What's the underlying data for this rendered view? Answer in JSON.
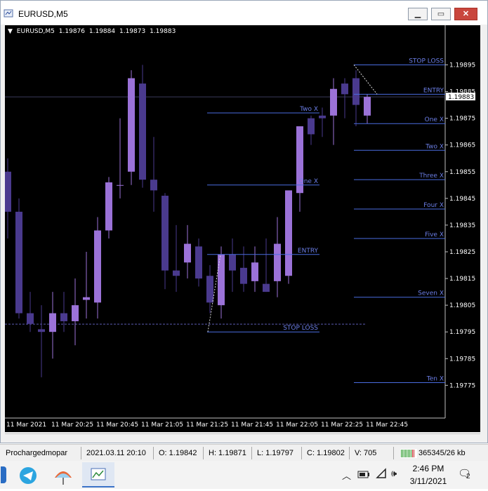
{
  "window": {
    "title": "EURUSD,M5"
  },
  "chart_header": {
    "symbol": "EURUSD,M5",
    "ohlc": [
      "1.19876",
      "1.19884",
      "1.19873",
      "1.19883"
    ]
  },
  "current_price_label": "1.19883",
  "y_axis_ticks": [
    "1.19895",
    "1.19885",
    "1.19875",
    "1.19865",
    "1.19855",
    "1.19845",
    "1.19835",
    "1.19825",
    "1.19815",
    "1.19805",
    "1.19795",
    "1.19785",
    "1.19775"
  ],
  "x_axis_ticks": [
    "11 Mar 2021",
    "11 Mar 20:25",
    "11 Mar 20:45",
    "11 Mar 21:05",
    "11 Mar 21:25",
    "11 Mar 21:45",
    "11 Mar 22:05",
    "11 Mar 22:25",
    "11 Mar 22:45"
  ],
  "chart_data": {
    "type": "candlestick",
    "ylim": [
      1.19768,
      1.19903
    ],
    "bull_color": "#9b72d8",
    "bear_color": "#4a3a8e",
    "candles": [
      [
        1.19855,
        1.1986,
        1.1983,
        1.1984
      ],
      [
        1.1984,
        1.19845,
        1.198,
        1.19802
      ],
      [
        1.19802,
        1.1981,
        1.19795,
        1.19798
      ],
      [
        1.19796,
        1.19805,
        1.19778,
        1.19795
      ],
      [
        1.19795,
        1.1981,
        1.19785,
        1.19802
      ],
      [
        1.19802,
        1.1981,
        1.19795,
        1.19799
      ],
      [
        1.19799,
        1.19815,
        1.1979,
        1.19805
      ],
      [
        1.19807,
        1.19825,
        1.198,
        1.19808
      ],
      [
        1.19806,
        1.19838,
        1.198,
        1.19833
      ],
      [
        1.19833,
        1.19853,
        1.1983,
        1.19851
      ],
      [
        1.1985,
        1.19875,
        1.19845,
        1.1985
      ],
      [
        1.19855,
        1.19893,
        1.1985,
        1.1989
      ],
      [
        1.19888,
        1.19895,
        1.19849,
        1.19852
      ],
      [
        1.19852,
        1.19868,
        1.1984,
        1.19848
      ],
      [
        1.19846,
        1.19847,
        1.19811,
        1.19818
      ],
      [
        1.19818,
        1.19835,
        1.1981,
        1.19816
      ],
      [
        1.19821,
        1.19835,
        1.19815,
        1.19828
      ],
      [
        1.19827,
        1.1983,
        1.19812,
        1.19815
      ],
      [
        1.19816,
        1.1982,
        1.19802,
        1.19806
      ],
      [
        1.19805,
        1.19827,
        1.198,
        1.19824
      ],
      [
        1.19824,
        1.1983,
        1.1981,
        1.19818
      ],
      [
        1.19819,
        1.19827,
        1.1981,
        1.19813
      ],
      [
        1.19814,
        1.19827,
        1.1981,
        1.19821
      ],
      [
        1.19813,
        1.1983,
        1.1981,
        1.1981
      ],
      [
        1.19814,
        1.19838,
        1.19808,
        1.19828
      ],
      [
        1.19816,
        1.19845,
        1.19813,
        1.19848
      ],
      [
        1.19847,
        1.1987,
        1.1984,
        1.19872
      ],
      [
        1.19875,
        1.19876,
        1.19865,
        1.19869
      ],
      [
        1.19876,
        1.19879,
        1.19868,
        1.19875
      ],
      [
        1.19876,
        1.1989,
        1.19865,
        1.19886
      ],
      [
        1.19888,
        1.1989,
        1.19875,
        1.19884
      ],
      [
        1.1989,
        1.19893,
        1.19872,
        1.1988
      ],
      [
        1.19876,
        1.19884,
        1.19873,
        1.19883
      ]
    ],
    "trade_1": {
      "levels": [
        {
          "label": "Two X",
          "price": 1.19877
        },
        {
          "label": "One X",
          "price": 1.1985
        },
        {
          "label": "ENTRY",
          "price": 1.19824
        },
        {
          "label": "STOP LOSS",
          "price": 1.19795
        }
      ]
    },
    "trade_2": {
      "levels": [
        {
          "label": "STOP LOSS",
          "price": 1.19895
        },
        {
          "label": "ENTRY",
          "price": 1.19884
        },
        {
          "label": "One X",
          "price": 1.19873
        },
        {
          "label": "Two X",
          "price": 1.19863
        },
        {
          "label": "Three X",
          "price": 1.19852
        },
        {
          "label": "Four X",
          "price": 1.19841
        },
        {
          "label": "Five X",
          "price": 1.1983
        },
        {
          "label": "Seven X",
          "price": 1.19808
        },
        {
          "label": "Ten X",
          "price": 1.19776
        }
      ]
    },
    "hline_price": 1.198,
    "dotted_hline_price": 1.198,
    "grid": false
  },
  "status_bar": {
    "account": "Prochargedmopar",
    "datetime": "2021.03.11 20:10",
    "open": "O: 1.19842",
    "high": "H: 1.19871",
    "low": "L: 1.19797",
    "close": "C: 1.19802",
    "volume": "V: 705",
    "traffic": "365345/26 kb"
  },
  "taskbar": {
    "time": "2:46 PM",
    "date": "3/11/2021",
    "notifications": "2"
  },
  "colors": {
    "chart_bg": "#000000",
    "level_line": "#4a6ce0",
    "level_text": "#6b7ee6",
    "axis_text": "#ffffff"
  }
}
